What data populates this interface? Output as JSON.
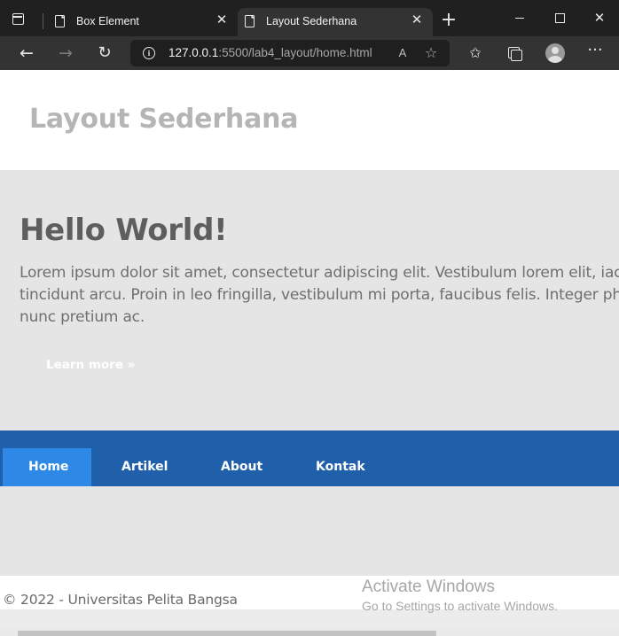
{
  "browser": {
    "tabs": [
      {
        "title": "Box Element",
        "icon": "document-icon",
        "close": "✕",
        "active": false
      },
      {
        "title": "Layout Sederhana",
        "icon": "document-icon",
        "close": "✕",
        "active": true
      }
    ],
    "new_tab": "+",
    "window": {
      "close": "✕"
    },
    "nav": {
      "back": "←",
      "forward": "→",
      "reload": "↻"
    },
    "address": {
      "info": "i",
      "host": "127.0.0.1",
      "path": ":5500/lab4_layout/home.html"
    },
    "address_icons": {
      "read_aloud": "A",
      "add_favorite": "☆"
    },
    "toolbar_icons": {
      "favorites": "✩",
      "more": "···"
    }
  },
  "page": {
    "site_title": "Layout Sederhana",
    "hero": {
      "heading": "Hello World!",
      "lines": [
        "Lorem ipsum dolor sit amet, consectetur adipiscing elit. Vestibulum lorem elit, iac",
        "tincidunt arcu. Proin in leo fringilla, vestibulum mi porta, faucibus felis. Integer ph",
        "nunc pretium ac."
      ],
      "cta": "Learn more »"
    },
    "nav": [
      {
        "label": "Home",
        "active": true
      },
      {
        "label": "Artikel",
        "active": false
      },
      {
        "label": "About",
        "active": false
      },
      {
        "label": "Kontak",
        "active": false
      }
    ],
    "footer": "© 2022 - Universitas Pelita Bangsa"
  },
  "os_watermark": {
    "title": "Activate Windows",
    "subtitle": "Go to Settings to activate Windows."
  },
  "colors": {
    "nav_bar": "#2060aa",
    "nav_active": "#2e88e6",
    "hero_bg": "#e5e5e5",
    "title_text": "#b5b5b5"
  }
}
